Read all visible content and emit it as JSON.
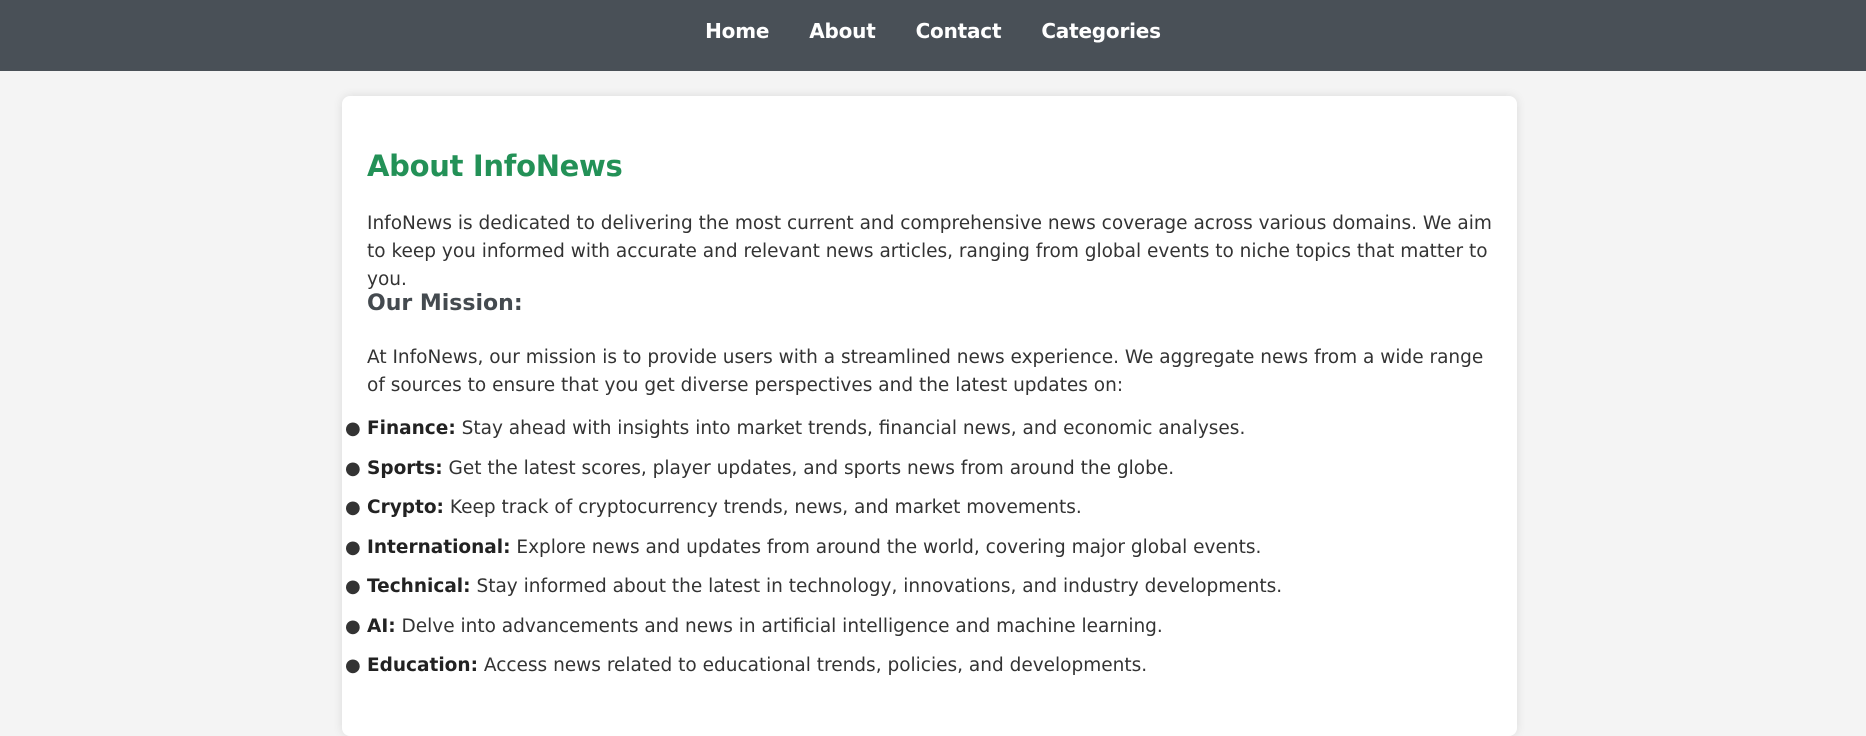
{
  "nav": {
    "items": [
      {
        "label": "Home"
      },
      {
        "label": "About"
      },
      {
        "label": "Contact"
      },
      {
        "label": "Categories"
      }
    ]
  },
  "page": {
    "title": "About InfoNews",
    "intro": "InfoNews is dedicated to delivering the most current and comprehensive news coverage across various domains. We aim to keep you informed with accurate and relevant news articles, ranging from global events to niche topics that matter to you.",
    "mission_heading": "Our Mission:",
    "mission_text": "At InfoNews, our mission is to provide users with a streamlined news experience. We aggregate news from a wide range of sources to ensure that you get diverse perspectives and the latest updates on:",
    "topics": [
      {
        "name": "Finance:",
        "text": "Stay ahead with insights into market trends, financial news, and economic analyses."
      },
      {
        "name": "Sports:",
        "text": "Get the latest scores, player updates, and sports news from around the globe."
      },
      {
        "name": "Crypto:",
        "text": "Keep track of cryptocurrency trends, news, and market movements."
      },
      {
        "name": "International:",
        "text": "Explore news and updates from around the world, covering major global events."
      },
      {
        "name": "Technical:",
        "text": "Stay informed about the latest in technology, innovations, and industry developments."
      },
      {
        "name": "AI:",
        "text": "Delve into advancements and news in artificial intelligence and machine learning."
      },
      {
        "name": "Education:",
        "text": "Access news related to educational trends, policies, and developments."
      }
    ]
  },
  "colors": {
    "nav_background": "#495057",
    "title_green": "#239157",
    "page_background": "#f4f4f4"
  }
}
